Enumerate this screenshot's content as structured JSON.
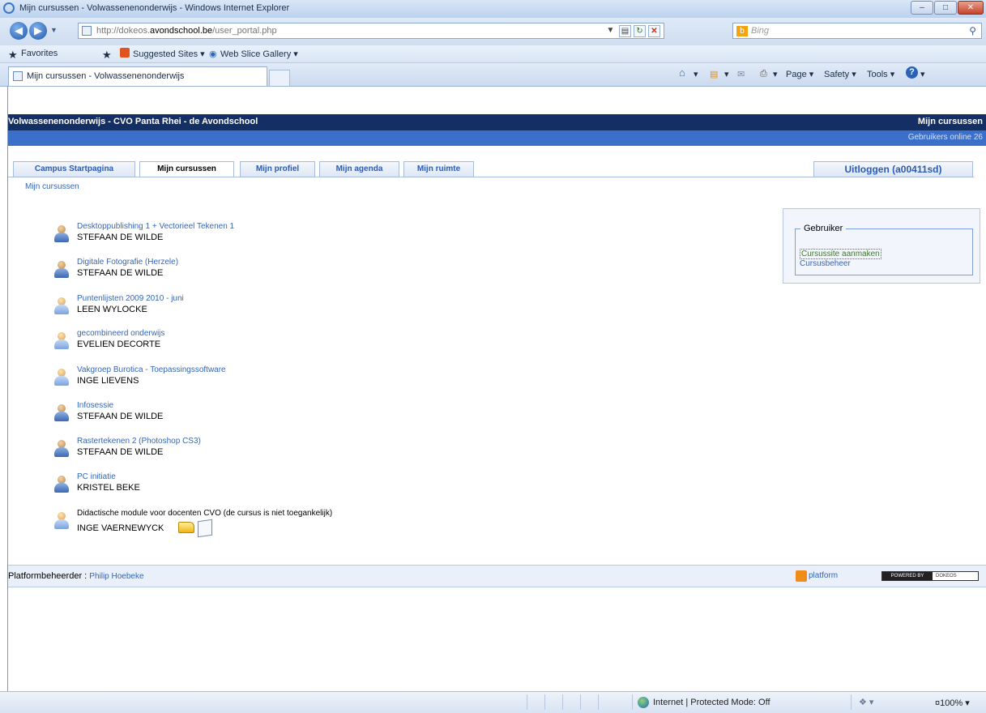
{
  "window": {
    "title": "Mijn cursussen - Volwassenenonderwijs - Windows Internet Explorer",
    "minimize": "–",
    "maximize": "□",
    "close": "✕"
  },
  "address_bar": {
    "url_prefix": "http://dokeos.",
    "url_domain": "avondschool.be",
    "url_path": "/user_portal.php",
    "search_placeholder": "Bing",
    "search_icon": "magnifier-icon",
    "back_icon": "back-arrow-icon",
    "forward_icon": "forward-arrow-icon"
  },
  "favorites_bar": {
    "favorites": "Favorites",
    "suggested_sites": "Suggested Sites ▾",
    "web_slice_gallery": "Web Slice Gallery ▾"
  },
  "browser_tab": {
    "title": "Mijn cursussen - Volwassenenonderwijs"
  },
  "command_bar": {
    "page": "Page ▾",
    "safety": "Safety ▾",
    "tools": "Tools ▾"
  },
  "site": {
    "institution": "Volwassenenonderwijs - CVO Panta Rhei - de Avondschool",
    "section_title": "Mijn cursussen",
    "users_online": "Gebruikers online  26",
    "tabs": [
      {
        "label": "Campus Startpagina",
        "active": false
      },
      {
        "label": "Mijn cursussen",
        "active": true
      },
      {
        "label": "Mijn profiel",
        "active": false
      },
      {
        "label": "Mijn agenda",
        "active": false
      },
      {
        "label": "Mijn ruimte",
        "active": false
      }
    ],
    "logout": "Uitloggen (a00411sd)",
    "breadcrumb": "Mijn cursussen"
  },
  "courses": [
    {
      "name": "Desktoppublishing 1 + Vectorieel Tekenen 1",
      "teacher": "STEFAAN DE WILDE",
      "link": true
    },
    {
      "name": "Digitale Fotografie (Herzele)",
      "teacher": "STEFAAN DE WILDE",
      "link": true
    },
    {
      "name": "Puntenlijsten 2009 2010 - juni",
      "teacher": "LEEN WYLOCKE",
      "link": true
    },
    {
      "name": "gecombineerd onderwijs",
      "teacher": "EVELIEN DECORTE",
      "link": true
    },
    {
      "name": "Vakgroep Burotica - Toepassingssoftware",
      "teacher": "INGE LIEVENS",
      "link": true
    },
    {
      "name": "Infosessie",
      "teacher": "STEFAAN DE WILDE",
      "link": true
    },
    {
      "name": "Rastertekenen 2 (Photoshop CS3)",
      "teacher": "STEFAAN DE WILDE",
      "link": true
    },
    {
      "name": "PC initiatie",
      "teacher": "KRISTEL BEKE",
      "link": true
    },
    {
      "name": "Didactische module voor docenten CVO (de cursus is niet toegankelijk)",
      "teacher": "INGE VAERNEWYCK",
      "link": false
    }
  ],
  "user_box": {
    "legend": "Gebruiker",
    "create_course": "Cursussite aanmaken",
    "course_admin": "Cursusbeheer"
  },
  "footer": {
    "admin_label": "Platformbeheerder : ",
    "admin_name": "Philip Hoebeke",
    "platform": "platform",
    "powered_by": "POWERED BY",
    "brand": "DOKEOS"
  },
  "status_bar": {
    "zone": "Internet | Protected Mode: Off",
    "zoom": "¤100%  ▾"
  }
}
